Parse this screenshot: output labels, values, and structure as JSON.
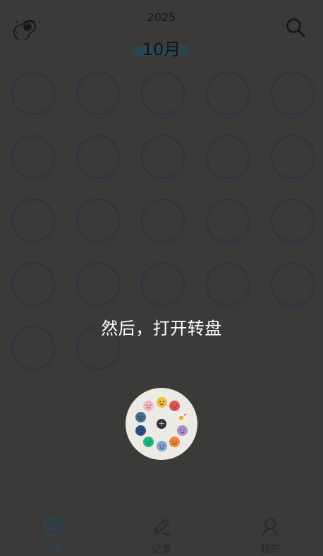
{
  "header": {
    "year": "2025",
    "month": "10月",
    "logo_icon": "spiral-icon",
    "search_icon": "search-icon"
  },
  "calendar": {
    "day_count": 22
  },
  "tutorial": {
    "caption": "然后，打开转盘"
  },
  "mood_wheel": {
    "center_icon": "plus-icon",
    "moods": [
      {
        "name": "happy",
        "color": "#f3bd3b"
      },
      {
        "name": "angry",
        "color": "#e05552"
      },
      {
        "name": "tea",
        "color": "#f1eee4"
      },
      {
        "name": "calm",
        "color": "#a990c4"
      },
      {
        "name": "excited",
        "color": "#f0813a"
      },
      {
        "name": "sad",
        "color": "#7ea4d8"
      },
      {
        "name": "relaxed",
        "color": "#1bb882"
      },
      {
        "name": "gloomy",
        "color": "#2e4d83"
      },
      {
        "name": "tired",
        "color": "#4c6c87"
      },
      {
        "name": "shy",
        "color": "#f1b9c6"
      }
    ]
  },
  "tabbar": {
    "tabs": [
      {
        "label": "心情",
        "icon": "smile-icon",
        "active": true
      },
      {
        "label": "记录",
        "icon": "pencil-icon",
        "active": false
      },
      {
        "label": "我的",
        "icon": "person-icon",
        "active": false
      }
    ],
    "active_color": "#1e4a63",
    "inactive_color": "#262626"
  }
}
